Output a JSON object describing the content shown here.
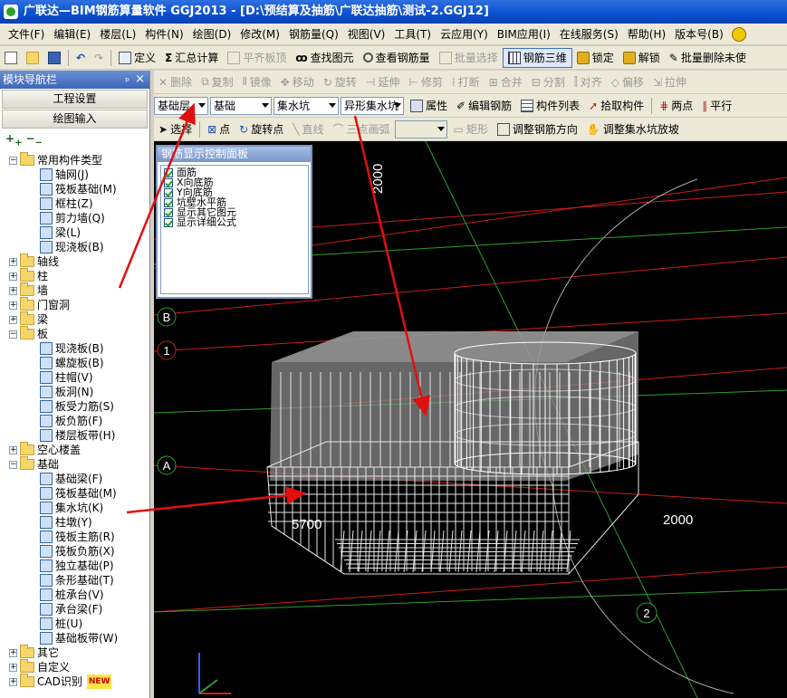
{
  "window": {
    "title": "广联达—BIM钢筋算量软件 GGJ2013 - [D:\\预结算及抽筋\\广联达抽筋\\测试-2.GGJ12]"
  },
  "menu": [
    "文件(F)",
    "编辑(E)",
    "楼层(L)",
    "构件(N)",
    "绘图(D)",
    "修改(M)",
    "钢筋量(Q)",
    "视图(V)",
    "工具(T)",
    "云应用(Y)",
    "BIM应用(I)",
    "在线服务(S)",
    "帮助(H)",
    "版本号(B)"
  ],
  "toolbar1": {
    "define": "定义",
    "summary": "汇总计算",
    "align_top": "平齐板顶",
    "find_element": "查找图元",
    "view_rebar": "查看钢筋量",
    "batch_select": "批量选择",
    "rebar_3d": "钢筋三维",
    "lock": "锁定",
    "unlock": "解锁",
    "batch_delete": "批量删除未使"
  },
  "toolbar_edit": {
    "delete": "删除",
    "copy": "复制",
    "mirror": "镜像",
    "move": "移动",
    "rotate": "旋转",
    "extend": "延伸",
    "trim": "修剪",
    "break": "打断",
    "merge": "合并",
    "split": "分割",
    "align": "对齐",
    "offset": "偏移",
    "stretch": "拉伸"
  },
  "toolbar2": {
    "floor": "基础层",
    "category": "基础",
    "type": "集水坑",
    "element": "异形集水坑",
    "properties": "属性",
    "edit_rebar": "编辑钢筋",
    "element_list": "构件列表",
    "pick_element": "拾取构件",
    "two_points": "两点",
    "parallel": "平行"
  },
  "toolbar3": {
    "select": "选择",
    "point": "点",
    "rotate_point": "旋转点",
    "line": "直线",
    "arc": "三点画弧",
    "rect": "矩形",
    "adjust_direction": "调整钢筋方向",
    "adjust_slope": "调整集水坑放坡"
  },
  "nav": {
    "title": "模块导航栏",
    "pin": "ᵖ",
    "close": "×",
    "btn_project": "工程设置",
    "btn_drawing": "绘图输入",
    "tree": [
      {
        "label": "常用构件类型",
        "level": 0,
        "kind": "folder",
        "expanded": true
      },
      {
        "label": "轴网(J)",
        "level": 1,
        "kind": "item"
      },
      {
        "label": "筏板基础(M)",
        "level": 1,
        "kind": "item"
      },
      {
        "label": "框柱(Z)",
        "level": 1,
        "kind": "item"
      },
      {
        "label": "剪力墙(Q)",
        "level": 1,
        "kind": "item"
      },
      {
        "label": "梁(L)",
        "level": 1,
        "kind": "item"
      },
      {
        "label": "现浇板(B)",
        "level": 1,
        "kind": "item"
      },
      {
        "label": "轴线",
        "level": 0,
        "kind": "folder",
        "expanded": false
      },
      {
        "label": "柱",
        "level": 0,
        "kind": "folder",
        "expanded": false
      },
      {
        "label": "墙",
        "level": 0,
        "kind": "folder",
        "expanded": false
      },
      {
        "label": "门窗洞",
        "level": 0,
        "kind": "folder",
        "expanded": false
      },
      {
        "label": "梁",
        "level": 0,
        "kind": "folder",
        "expanded": false
      },
      {
        "label": "板",
        "level": 0,
        "kind": "folder",
        "expanded": true
      },
      {
        "label": "现浇板(B)",
        "level": 1,
        "kind": "item"
      },
      {
        "label": "螺旋板(B)",
        "level": 1,
        "kind": "item"
      },
      {
        "label": "柱帽(V)",
        "level": 1,
        "kind": "item"
      },
      {
        "label": "板洞(N)",
        "level": 1,
        "kind": "item"
      },
      {
        "label": "板受力筋(S)",
        "level": 1,
        "kind": "item"
      },
      {
        "label": "板负筋(F)",
        "level": 1,
        "kind": "item"
      },
      {
        "label": "楼层板带(H)",
        "level": 1,
        "kind": "item"
      },
      {
        "label": "空心楼盖",
        "level": 0,
        "kind": "folder",
        "expanded": false
      },
      {
        "label": "基础",
        "level": 0,
        "kind": "folder",
        "expanded": true
      },
      {
        "label": "基础梁(F)",
        "level": 1,
        "kind": "item"
      },
      {
        "label": "筏板基础(M)",
        "level": 1,
        "kind": "item"
      },
      {
        "label": "集水坑(K)",
        "level": 1,
        "kind": "item"
      },
      {
        "label": "柱墩(Y)",
        "level": 1,
        "kind": "item"
      },
      {
        "label": "筏板主筋(R)",
        "level": 1,
        "kind": "item"
      },
      {
        "label": "筏板负筋(X)",
        "level": 1,
        "kind": "item"
      },
      {
        "label": "独立基础(P)",
        "level": 1,
        "kind": "item"
      },
      {
        "label": "条形基础(T)",
        "level": 1,
        "kind": "item"
      },
      {
        "label": "桩承台(V)",
        "level": 1,
        "kind": "item"
      },
      {
        "label": "承台梁(F)",
        "level": 1,
        "kind": "item"
      },
      {
        "label": "桩(U)",
        "level": 1,
        "kind": "item"
      },
      {
        "label": "基础板带(W)",
        "level": 1,
        "kind": "item"
      },
      {
        "label": "其它",
        "level": 0,
        "kind": "folder",
        "expanded": false
      },
      {
        "label": "自定义",
        "level": 0,
        "kind": "folder",
        "expanded": false
      },
      {
        "label": "CAD识别",
        "level": 0,
        "kind": "folder",
        "expanded": false,
        "badge": "NEW"
      }
    ]
  },
  "rebar_panel": {
    "title": "钢筋显示控制面板",
    "options": [
      {
        "label": "面筋",
        "checked": true
      },
      {
        "label": "X向底筋",
        "checked": true
      },
      {
        "label": "Y向底筋",
        "checked": true
      },
      {
        "label": "坑壁水平筋",
        "checked": true
      },
      {
        "label": "显示其它图元",
        "checked": true
      },
      {
        "label": "显示详细公式",
        "checked": true
      }
    ]
  },
  "viewport": {
    "axis_labels": [
      "B",
      "1",
      "A",
      "2"
    ],
    "dimensions": [
      "2000",
      "2000",
      "5700"
    ],
    "colors": {
      "background": "#000000",
      "grid_red": "#c81e1e",
      "grid_green": "#2e9e2e",
      "rebar": "#ffffff",
      "concrete": "#8a8a8a"
    }
  }
}
